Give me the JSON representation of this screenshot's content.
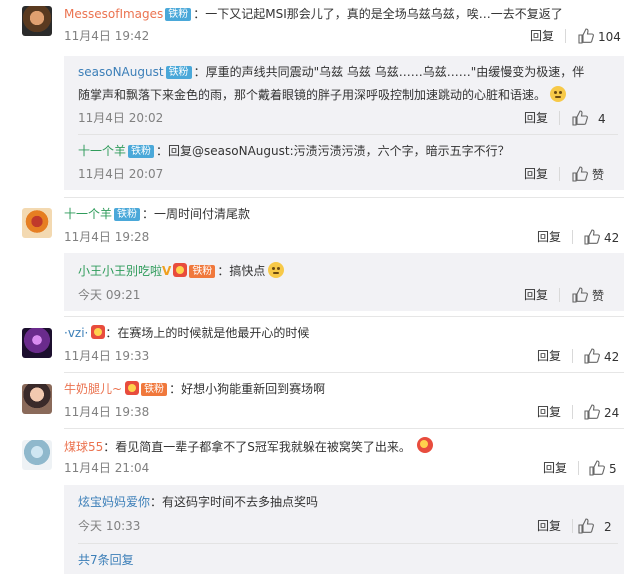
{
  "colors": {
    "accent": "#eb7350",
    "reply_name": "#3c7fb8",
    "badge": "#4aa8d9",
    "muted": "#808080",
    "reply_bg": "#f2f2f5"
  },
  "reply_label": "回复",
  "comments": [
    {
      "user": "MessesofImages",
      "badge": "铁粉",
      "text": "：一下又记起MSI那会儿了，真的是全场乌兹乌兹，唉…一去不复返了",
      "time": "11月4日 19:42",
      "likes": "104",
      "replies": [
        {
          "user": "seasoNAugust",
          "badge": "铁粉",
          "text_line1": "：厚重的声线共同震动\"乌兹 乌兹 乌兹……乌兹……\"由缓慢变为极速，伴",
          "text_line2": "随掌声和飘落下来金色的雨，那个戴着眼镜的胖子用深呼吸控制加速跳动的心脏和语速。",
          "time": "11月4日 20:02",
          "likes": "4"
        },
        {
          "user": "十一个羊",
          "badge": "铁粉",
          "text": "：回复@seasoNAugust:污渍污渍污渍，六个字，暗示五字不行？",
          "time": "11月4日 20:07",
          "likes": "赞"
        }
      ]
    },
    {
      "user": "十一个羊",
      "badge": "铁粉",
      "text": "：一周时间付清尾款",
      "time": "11月4日 19:28",
      "likes": "42",
      "replies": [
        {
          "user": "小王小王别吃啦",
          "badge": "铁粉",
          "text": "：搞快点",
          "time": "今天 09:21",
          "likes": "赞"
        }
      ]
    },
    {
      "user": "·vzi·",
      "badge": "",
      "text": "：在赛场上的时候就是他最开心的时候",
      "time": "11月4日 19:33",
      "likes": "42"
    },
    {
      "user": "牛奶腿儿~",
      "badge": "铁粉",
      "text": "：好想小狗能重新回到赛场啊",
      "time": "11月4日 19:38",
      "likes": "24"
    },
    {
      "user": "煤球55",
      "badge": "",
      "text": "：看见简直一辈子都拿不了S冠军我就躲在被窝笑了出来。",
      "time": "11月4日 21:04",
      "likes": "5",
      "replies": [
        {
          "user": "炫宝妈妈爱你",
          "badge": "",
          "text": "：有这码字时间不去多抽点奖吗",
          "time": "今天 10:33",
          "likes": "2"
        }
      ],
      "more": "共7条回复"
    }
  ]
}
